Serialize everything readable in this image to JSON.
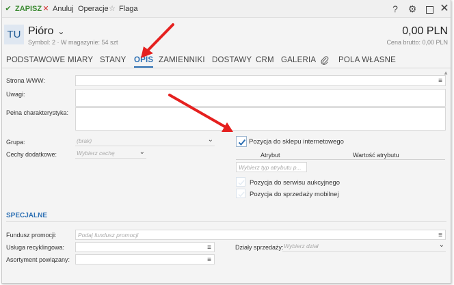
{
  "toolbar": {
    "save": "ZAPISZ",
    "cancel": "Anuluj",
    "operations": "Operacje",
    "flag": "Flaga",
    "help": "?"
  },
  "header": {
    "avatar": "TU",
    "name": "Pióro",
    "meta": "Symbol: 2  ·  W magazynie: 54 szt",
    "price": "0,00 PLN",
    "price_sub": "Cena brutto: 0,00 PLN"
  },
  "tabs": [
    "PODSTAWOWE",
    "MIARY",
    "STANY",
    "OPIS",
    "ZAMIENNIKI",
    "DOSTAWY",
    "CRM",
    "GALERIA",
    "POLA WŁASNE"
  ],
  "form": {
    "www_label": "Strona WWW:",
    "notes_label": "Uwagi:",
    "full_label": "Pełna charakterystyka:",
    "group_label": "Grupa:",
    "group_value": "(brak)",
    "features_label": "Cechy dodatkowe:",
    "features_placeholder": "Wybierz cechę",
    "shop_checkbox": "Pozycja do sklepu internetowego",
    "shop_checked": true,
    "attr_header": "Atrybut",
    "attr_value_header": "Wartość atrybutu",
    "attr_placeholder": "Wybierz typ atrybutu p...",
    "auction_checkbox": "Pozycja do serwisu aukcyjnego",
    "mobile_checkbox": "Pozycja do sprzedaży mobilnej"
  },
  "special": {
    "title": "SPECJALNE",
    "promo_label": "Fundusz promocji:",
    "promo_placeholder": "Podaj fundusz promocji",
    "recycle_label": "Usługa recyklingowa:",
    "related_label": "Asortyment powiązany:",
    "sales_label": "Działy sprzedaży:",
    "sales_placeholder": "Wybierz dział"
  },
  "icons": {
    "save": "check-icon",
    "cancel": "x-icon",
    "flag": "star-icon",
    "menu": "hamburger-icon",
    "attachment": "paperclip-icon"
  },
  "colors": {
    "accent": "#2c6fb3",
    "save": "#3c8a32",
    "cancel": "#d32d2d",
    "arrow": "#e5201f"
  }
}
